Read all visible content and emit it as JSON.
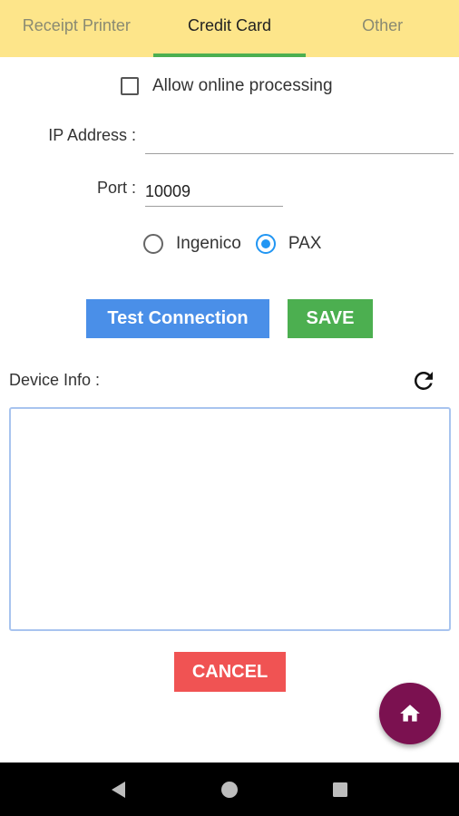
{
  "tabs": [
    {
      "label": "Receipt Printer",
      "active": false
    },
    {
      "label": "Credit Card",
      "active": true
    },
    {
      "label": "Other",
      "active": false
    }
  ],
  "online_processing": {
    "label": "Allow online processing",
    "checked": false
  },
  "ip_address": {
    "label": "IP Address :",
    "value": ""
  },
  "port": {
    "label": "Port :",
    "value": "10009"
  },
  "device_type": {
    "options": [
      {
        "label": "Ingenico",
        "selected": false
      },
      {
        "label": "PAX",
        "selected": true
      }
    ]
  },
  "buttons": {
    "test_connection": "Test Connection",
    "save": "SAVE",
    "cancel": "CANCEL"
  },
  "device_info": {
    "label": "Device Info :",
    "content": ""
  },
  "icons": {
    "refresh": "refresh-icon",
    "home": "home-icon",
    "nav_back": "back-triangle-icon",
    "nav_home": "home-circle-icon",
    "nav_recents": "recents-square-icon"
  },
  "colors": {
    "tabbar": "#fde58a",
    "tab_indicator": "#4caf50",
    "test_button": "#4a8fe8",
    "save_button": "#4caf50",
    "cancel_button": "#f05353",
    "fab": "#7b1150",
    "radio_accent": "#2196f3"
  }
}
